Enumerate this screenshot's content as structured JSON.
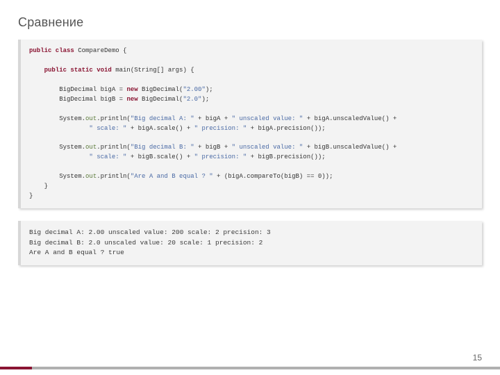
{
  "title": "Сравнение",
  "code": {
    "tokens": [
      [
        [
          "kw",
          "public class"
        ],
        [
          "",
          " CompareDemo {"
        ]
      ],
      [
        [
          "",
          ""
        ]
      ],
      [
        [
          "",
          "    "
        ],
        [
          "kw",
          "public static void"
        ],
        [
          "",
          " main(String[] args) {"
        ]
      ],
      [
        [
          "",
          ""
        ]
      ],
      [
        [
          "",
          "        BigDecimal bigA = "
        ],
        [
          "kw",
          "new"
        ],
        [
          "",
          " BigDecimal("
        ],
        [
          "str",
          "\"2.00\""
        ],
        [
          "",
          ");"
        ]
      ],
      [
        [
          "",
          "        BigDecimal bigB = "
        ],
        [
          "kw",
          "new"
        ],
        [
          "",
          " BigDecimal("
        ],
        [
          "str",
          "\"2.0\""
        ],
        [
          "",
          ");"
        ]
      ],
      [
        [
          "",
          ""
        ]
      ],
      [
        [
          "",
          "        System."
        ],
        [
          "field",
          "out"
        ],
        [
          "",
          ".println("
        ],
        [
          "str",
          "\"Big decimal A: \""
        ],
        [
          "",
          " + bigA + "
        ],
        [
          "str",
          "\" unscaled value: \""
        ],
        [
          "",
          " + bigA.unscaledValue() +"
        ]
      ],
      [
        [
          "",
          "                "
        ],
        [
          "str",
          "\" scale: \""
        ],
        [
          "",
          " + bigA.scale() + "
        ],
        [
          "str",
          "\" precision: \""
        ],
        [
          "",
          " + bigA.precision());"
        ]
      ],
      [
        [
          "",
          ""
        ]
      ],
      [
        [
          "",
          "        System."
        ],
        [
          "field",
          "out"
        ],
        [
          "",
          ".println("
        ],
        [
          "str",
          "\"Big decimal B: \""
        ],
        [
          "",
          " + bigB + "
        ],
        [
          "str",
          "\" unscaled value: \""
        ],
        [
          "",
          " + bigB.unscaledValue() +"
        ]
      ],
      [
        [
          "",
          "                "
        ],
        [
          "str",
          "\" scale: \""
        ],
        [
          "",
          " + bigB.scale() + "
        ],
        [
          "str",
          "\" precision: \""
        ],
        [
          "",
          " + bigB.precision());"
        ]
      ],
      [
        [
          "",
          ""
        ]
      ],
      [
        [
          "",
          "        System."
        ],
        [
          "field",
          "out"
        ],
        [
          "",
          ".println("
        ],
        [
          "str",
          "\"Are A and B equal ? \""
        ],
        [
          "",
          " + (bigA.compareTo(bigB) == 0));"
        ]
      ],
      [
        [
          "",
          "    }"
        ]
      ],
      [
        [
          "",
          "}"
        ]
      ]
    ]
  },
  "output": "Big decimal A: 2.00 unscaled value: 200 scale: 2 precision: 3\nBig decimal B: 2.0 unscaled value: 20 scale: 1 precision: 2\nAre A and B equal ? true",
  "page_number": "15"
}
